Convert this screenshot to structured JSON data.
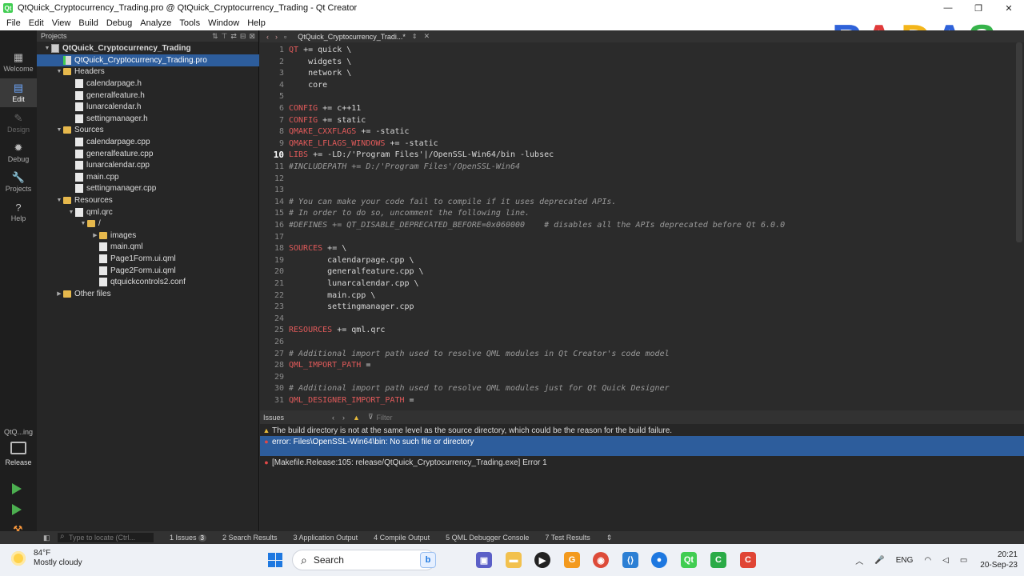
{
  "window": {
    "title": "QtQuick_Cryptocurrency_Trading.pro @ QtQuick_Cryptocurrency_Trading - Qt Creator",
    "minimize": "—",
    "maximize": "❐",
    "close": "✕"
  },
  "menu": [
    "File",
    "Edit",
    "View",
    "Build",
    "Debug",
    "Analyze",
    "Tools",
    "Window",
    "Help"
  ],
  "modes": [
    {
      "label": "Welcome",
      "icon": "grid-icon"
    },
    {
      "label": "Edit",
      "icon": "document-icon"
    },
    {
      "label": "Design",
      "icon": "pen-icon"
    },
    {
      "label": "Debug",
      "icon": "bug-icon"
    },
    {
      "label": "Projects",
      "icon": "wrench-icon"
    },
    {
      "label": "Help",
      "icon": "help-icon"
    }
  ],
  "kit": {
    "name": "QtQ...ing",
    "config": "Release"
  },
  "projects_panel": {
    "title": "Projects",
    "tree": [
      {
        "label": "QtQuick_Cryptocurrency_Trading",
        "depth": 0,
        "type": "projroot",
        "expanded": true
      },
      {
        "label": "QtQuick_Cryptocurrency_Trading.pro",
        "depth": 1,
        "type": "pro",
        "selected": true
      },
      {
        "label": "Headers",
        "depth": 1,
        "type": "folder",
        "expanded": true
      },
      {
        "label": "calendarpage.h",
        "depth": 2,
        "type": "file"
      },
      {
        "label": "generalfeature.h",
        "depth": 2,
        "type": "file"
      },
      {
        "label": "lunarcalendar.h",
        "depth": 2,
        "type": "file"
      },
      {
        "label": "settingmanager.h",
        "depth": 2,
        "type": "file"
      },
      {
        "label": "Sources",
        "depth": 1,
        "type": "folder",
        "expanded": true
      },
      {
        "label": "calendarpage.cpp",
        "depth": 2,
        "type": "file"
      },
      {
        "label": "generalfeature.cpp",
        "depth": 2,
        "type": "file"
      },
      {
        "label": "lunarcalendar.cpp",
        "depth": 2,
        "type": "file"
      },
      {
        "label": "main.cpp",
        "depth": 2,
        "type": "file"
      },
      {
        "label": "settingmanager.cpp",
        "depth": 2,
        "type": "file"
      },
      {
        "label": "Resources",
        "depth": 1,
        "type": "folder",
        "expanded": true
      },
      {
        "label": "qml.qrc",
        "depth": 2,
        "type": "file",
        "expanded": true
      },
      {
        "label": "/",
        "depth": 3,
        "type": "folder",
        "expanded": true
      },
      {
        "label": "images",
        "depth": 4,
        "type": "folder",
        "expanded": false
      },
      {
        "label": "main.qml",
        "depth": 4,
        "type": "file"
      },
      {
        "label": "Page1Form.ui.qml",
        "depth": 4,
        "type": "file"
      },
      {
        "label": "Page2Form.ui.qml",
        "depth": 4,
        "type": "file"
      },
      {
        "label": "qtquickcontrols2.conf",
        "depth": 4,
        "type": "file"
      },
      {
        "label": "Other files",
        "depth": 1,
        "type": "folder",
        "expanded": false
      }
    ]
  },
  "editor_tab": {
    "name": "QtQuick_Cryptocurrency_Tradi...*"
  },
  "editor": {
    "current_line": 10,
    "lines": [
      {
        "n": "1",
        "parts": [
          [
            "var",
            "QT"
          ],
          [
            "op",
            " += quick \\"
          ]
        ]
      },
      {
        "n": "2",
        "parts": [
          [
            "op",
            "    widgets \\"
          ]
        ]
      },
      {
        "n": "3",
        "parts": [
          [
            "op",
            "    network \\"
          ]
        ]
      },
      {
        "n": "4",
        "parts": [
          [
            "op",
            "    core"
          ]
        ]
      },
      {
        "n": "5",
        "parts": []
      },
      {
        "n": "6",
        "parts": [
          [
            "var",
            "CONFIG"
          ],
          [
            "op",
            " += c++11"
          ]
        ]
      },
      {
        "n": "7",
        "parts": [
          [
            "var",
            "CONFIG"
          ],
          [
            "op",
            " += static"
          ]
        ]
      },
      {
        "n": "8",
        "parts": [
          [
            "var",
            "QMAKE_CXXFLAGS"
          ],
          [
            "op",
            " += -static"
          ]
        ]
      },
      {
        "n": "9",
        "parts": [
          [
            "var",
            "QMAKE_LFLAGS_WINDOWS"
          ],
          [
            "op",
            " += -static"
          ]
        ]
      },
      {
        "n": "10",
        "parts": [
          [
            "var",
            "LIBS"
          ],
          [
            "op",
            " += -LD:/'Program Files'|/OpenSSL-Win64/bin -lubsec"
          ]
        ]
      },
      {
        "n": "11",
        "parts": [
          [
            "comment",
            "#INCLUDEPATH += D:/'Program Files'/OpenSSL-Win64"
          ]
        ]
      },
      {
        "n": "12",
        "parts": []
      },
      {
        "n": "13",
        "parts": []
      },
      {
        "n": "14",
        "parts": [
          [
            "comment",
            "# You can make your code fail to compile if it uses deprecated APIs."
          ]
        ]
      },
      {
        "n": "15",
        "parts": [
          [
            "comment",
            "# In order to do so, uncomment the following line."
          ]
        ]
      },
      {
        "n": "16",
        "parts": [
          [
            "comment",
            "#DEFINES += QT_DISABLE_DEPRECATED_BEFORE=0x060000    # disables all the APIs deprecated before Qt 6.0.0"
          ]
        ]
      },
      {
        "n": "17",
        "parts": []
      },
      {
        "n": "18",
        "parts": [
          [
            "var",
            "SOURCES"
          ],
          [
            "op",
            " += \\"
          ]
        ]
      },
      {
        "n": "19",
        "parts": [
          [
            "op",
            "        calendarpage.cpp \\"
          ]
        ]
      },
      {
        "n": "20",
        "parts": [
          [
            "op",
            "        generalfeature.cpp \\"
          ]
        ]
      },
      {
        "n": "21",
        "parts": [
          [
            "op",
            "        lunarcalendar.cpp \\"
          ]
        ]
      },
      {
        "n": "22",
        "parts": [
          [
            "op",
            "        main.cpp \\"
          ]
        ]
      },
      {
        "n": "23",
        "parts": [
          [
            "op",
            "        settingmanager.cpp"
          ]
        ]
      },
      {
        "n": "24",
        "parts": []
      },
      {
        "n": "25",
        "parts": [
          [
            "var",
            "RESOURCES"
          ],
          [
            "op",
            " += qml.qrc"
          ]
        ]
      },
      {
        "n": "26",
        "parts": []
      },
      {
        "n": "27",
        "parts": [
          [
            "comment",
            "# Additional import path used to resolve QML modules in Qt Creator's code model"
          ]
        ]
      },
      {
        "n": "28",
        "parts": [
          [
            "var",
            "QML_IMPORT_PATH"
          ],
          [
            "op",
            " ="
          ]
        ]
      },
      {
        "n": "29",
        "parts": []
      },
      {
        "n": "30",
        "parts": [
          [
            "comment",
            "# Additional import path used to resolve QML modules just for Qt Quick Designer"
          ]
        ]
      },
      {
        "n": "31",
        "parts": [
          [
            "var",
            "QML_DESIGNER_IMPORT_PATH"
          ],
          [
            "op",
            " ="
          ]
        ]
      }
    ]
  },
  "issues_panel": {
    "title": "Issues",
    "filter_placeholder": "Filter",
    "items": [
      {
        "severity": "warning",
        "text": "The build directory is not at the same level as the source directory, which could be the reason for the build failure."
      },
      {
        "severity": "error",
        "text": "error: Files\\OpenSSL-Win64\\bin: No such file or directory",
        "selected": true
      },
      {
        "severity": "error",
        "text": "[Makefile.Release:105: release/QtQuick_Cryptocurrency_Trading.exe] Error 1"
      }
    ]
  },
  "statusbar": {
    "locator_placeholder": "Type to locate (Ctrl...",
    "tabs": [
      "1 Issues",
      "2 Search Results",
      "3 Application Output",
      "4 Compile Output",
      "5 QML Debugger Console",
      "7 Test Results"
    ],
    "issues_count": "3"
  },
  "taskbar": {
    "weather_temp": "84°F",
    "weather_desc": "Mostly cloudy",
    "search_label": "Search",
    "lang": "ENG",
    "time": "20:21",
    "date": "20-Sep-23"
  },
  "watermark": {
    "letters": [
      "R",
      "A",
      "D",
      "A",
      "S"
    ],
    "colors": [
      "#2f62d9",
      "#e03a3a",
      "#f3b51a",
      "#2f62d9",
      "#36b34a"
    ]
  },
  "colors": {
    "selection": "#2d5d9c",
    "accent": "#41cd52",
    "error": "#e04848",
    "warning": "#e5b93b"
  }
}
